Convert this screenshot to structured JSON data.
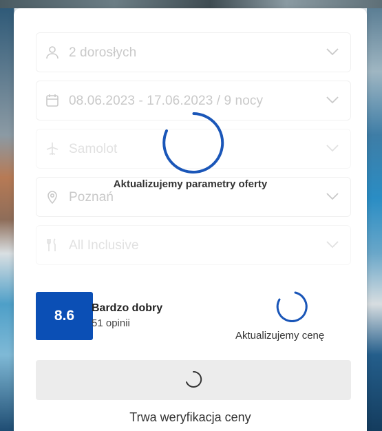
{
  "form": {
    "guests": {
      "value": "2 dorosłych",
      "icon": "person-icon"
    },
    "dates": {
      "value": "08.06.2023 - 17.06.2023 / 9 nocy",
      "icon": "calendar-icon"
    },
    "transport": {
      "value": "Samolot",
      "icon": "plane-icon"
    },
    "departure": {
      "value": "Poznań",
      "icon": "location-pin-icon"
    },
    "board": {
      "value": "All Inclusive",
      "icon": "cutlery-icon"
    }
  },
  "overlay": {
    "label": "Aktualizujemy parametry oferty"
  },
  "rating": {
    "score": "8.6",
    "title": "Bardzo dobry",
    "reviews": "51 opinii",
    "color": "#0b4fb5"
  },
  "price": {
    "status": "Aktualizujemy cenę"
  },
  "verify": {
    "label": "Trwa weryfikacja ceny"
  },
  "colors": {
    "accent": "#1a56b8",
    "spinner_gray": "#333333"
  }
}
